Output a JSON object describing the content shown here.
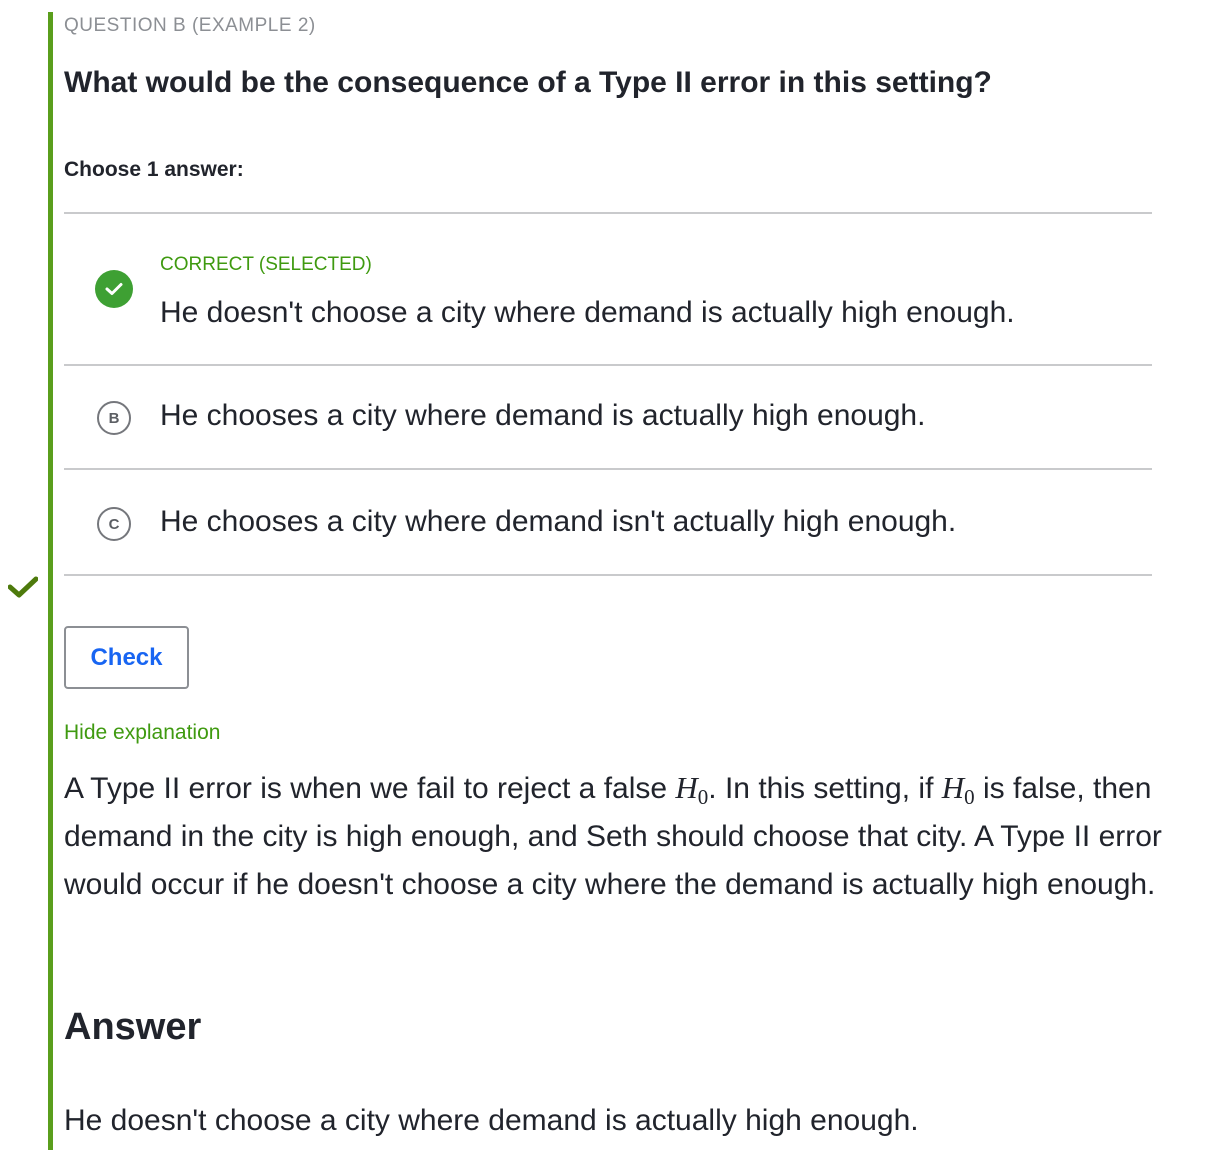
{
  "eyebrow": "QUESTION B (EXAMPLE 2)",
  "question": "What would be the consequence of a Type II error in this setting?",
  "choose_label": "Choose 1 answer:",
  "choices": [
    {
      "status": "CORRECT (SELECTED)",
      "text": "He doesn't choose a city where demand is actually high enough.",
      "badge": "check-icon",
      "selected": true,
      "correct": true
    },
    {
      "letter": "B",
      "text": "He chooses a city where demand is actually high enough.",
      "selected": false
    },
    {
      "letter": "C",
      "text": "He chooses a city where demand isn't actually high enough.",
      "selected": false
    }
  ],
  "check_button": "Check",
  "hide_explanation": "Hide explanation",
  "explanation": {
    "part1": "A Type II error is when we fail to reject a false ",
    "math_symbol": "H",
    "math_subscript": "0",
    "part2": ". In this setting, if ",
    "part3": " is false, then demand in the city is high enough, and Seth should choose that city. A Type II error would occur if he doesn't choose a city where the demand is actually high enough."
  },
  "answer_heading": "Answer",
  "answer_text": "He doesn't choose a city where demand is actually high enough.",
  "colors": {
    "accent_bar": "#5a9e1c",
    "correct_green": "#3ea033",
    "link_green": "#3f9a10",
    "button_blue": "#1865f2",
    "outer_check": "#4d7a0c"
  },
  "icons": {
    "outer_status": "checkmark-icon",
    "correct_badge": "check-icon"
  }
}
